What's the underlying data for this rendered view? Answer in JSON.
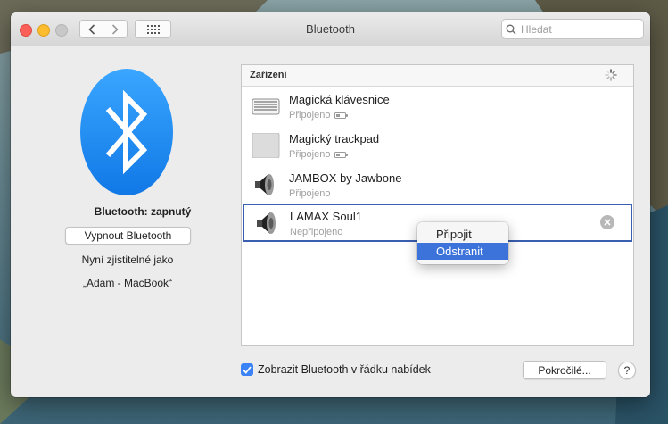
{
  "window": {
    "title": "Bluetooth"
  },
  "search": {
    "placeholder": "Hledat"
  },
  "bluetooth": {
    "status": "Bluetooth: zapnutý",
    "toggle_label": "Vypnout Bluetooth",
    "discoverable_label": "Nyní zjistitelné jako",
    "device_name": "„Adam - MacBook“"
  },
  "devices": {
    "header": "Zařízení",
    "items": [
      {
        "name": "Magická klávesnice",
        "status": "Připojeno",
        "icon": "keyboard-icon",
        "battery": true
      },
      {
        "name": "Magický trackpad",
        "status": "Připojeno",
        "icon": "trackpad-icon",
        "battery": true
      },
      {
        "name": "JAMBOX by Jawbone",
        "status": "Připojeno",
        "icon": "speaker-icon",
        "battery": false
      },
      {
        "name": "LAMAX Soul1",
        "status": "Nepřipojeno",
        "icon": "speaker-icon",
        "battery": false
      }
    ]
  },
  "context_menu": {
    "items": [
      "Připojit",
      "Odstranit"
    ],
    "highlighted": "Odstranit"
  },
  "footer": {
    "show_in_menubar_label": "Zobrazit Bluetooth v řádku nabídek",
    "show_in_menubar_checked": true,
    "advanced_label": "Pokročilé...",
    "help_label": "?"
  },
  "colors": {
    "accent": "#3b73db",
    "bluetooth_blue": "#1f8ff5",
    "selection_border": "#3a5fb0"
  }
}
